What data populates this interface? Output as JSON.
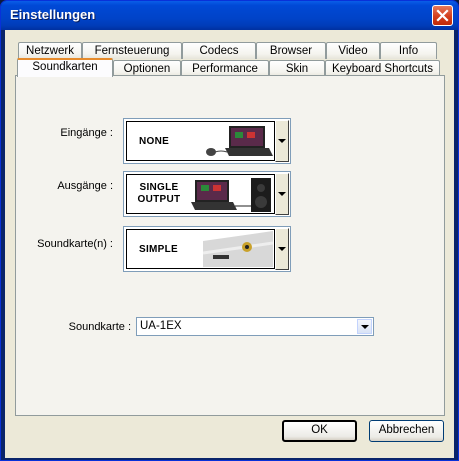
{
  "window": {
    "title": "Einstellungen"
  },
  "tabs_row1": [
    "Netzwerk",
    "Fernsteuerung",
    "Codecs",
    "Browser",
    "Video",
    "Info"
  ],
  "tabs_row2": [
    "Soundkarten",
    "Optionen",
    "Performance",
    "Skin",
    "Keyboard Shortcuts"
  ],
  "active_tab": "Soundkarten",
  "inputs": {
    "label": "Eingänge :",
    "value": "NONE"
  },
  "outputs": {
    "label": "Ausgänge :",
    "value_line1": "SINGLE",
    "value_line2": "OUTPUT"
  },
  "soundcards": {
    "label": "Soundkarte(n) :",
    "value": "SIMPLE"
  },
  "soundcard": {
    "label": "Soundkarte :",
    "value": "UA-1EX"
  },
  "buttons": {
    "ok": "OK",
    "cancel": "Abbrechen"
  }
}
